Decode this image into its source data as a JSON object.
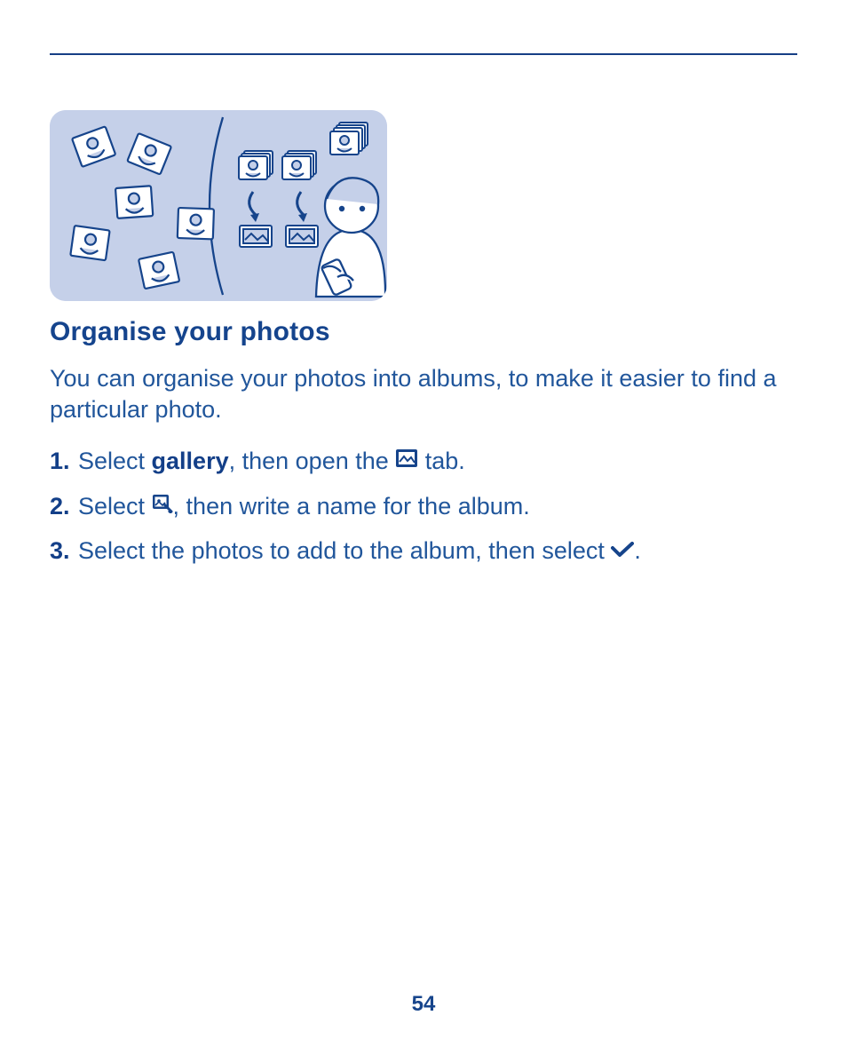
{
  "page_number": "54",
  "section": {
    "title": "Organise your photos",
    "intro": "You can organise your photos into albums, to make it easier to find a particular photo."
  },
  "steps": [
    {
      "num": "1.",
      "pre": "Select ",
      "bold": "gallery",
      "mid": ", then open the ",
      "icon": "image-tab-icon",
      "post": " tab."
    },
    {
      "num": "2.",
      "pre": "Select ",
      "icon": "new-album-icon",
      "post": ", then write a name for the album."
    },
    {
      "num": "3.",
      "pre": "Select the photos to add to the album, then select ",
      "icon": "done-check-icon",
      "post": "."
    }
  ]
}
